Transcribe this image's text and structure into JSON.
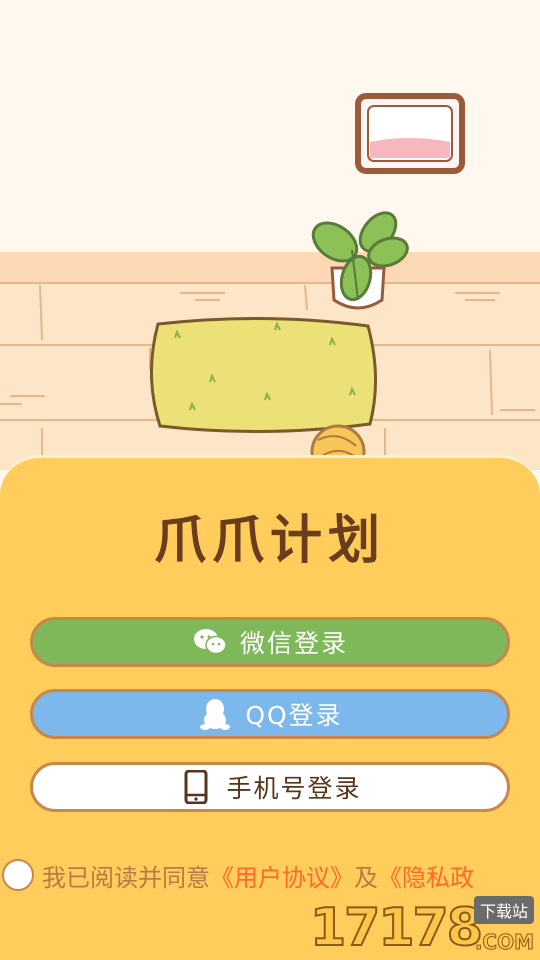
{
  "app": {
    "title": "爪爪计划"
  },
  "login": {
    "wechat_label": "微信登录",
    "qq_label": "QQ登录",
    "phone_label": "手机号登录"
  },
  "agreement": {
    "prefix": "我已阅读并同意",
    "user_agreement": "《用户协议》",
    "conjunction": "及",
    "privacy_policy": "《隐私政"
  },
  "watermark": {
    "number": "17178",
    "tag": "下载站",
    "domain": ".COM"
  },
  "colors": {
    "panel": "#ffcd5c",
    "wechat": "#7eb859",
    "qq": "#7cb8ec",
    "title": "#6a3d1e",
    "link": "#ff6a2b"
  },
  "icons": [
    "wechat-icon",
    "qq-penguin-icon",
    "phone-icon",
    "radio-unchecked-icon"
  ]
}
